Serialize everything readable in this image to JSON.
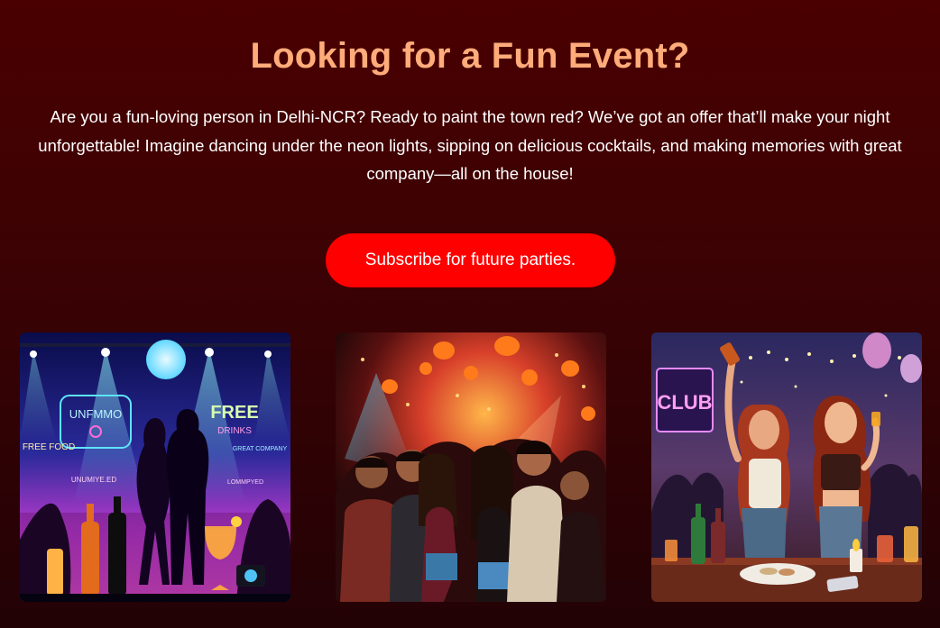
{
  "hero": {
    "title": "Looking for a Fun Event?",
    "description": "Are you a fun-loving person in Delhi-NCR? Ready to paint the town red? We’ve got an offer that’ll make your night unforgettable! Imagine dancing under the neon lights, sipping on delicious cocktails, and making memories with great company—all on the house!",
    "cta_label": "Subscribe for future parties."
  },
  "gallery": {
    "images": [
      {
        "neon_texts": [
          "UNFMMO",
          "FREE",
          "DRINKS",
          "FREE FOOD",
          "GREAT COMPANY",
          "UNUMIYE.ED",
          "LOMMPYED"
        ]
      },
      {
        "neon_texts": []
      },
      {
        "neon_texts": [
          "CLUB"
        ]
      }
    ]
  },
  "colors": {
    "title": "#ffac7a",
    "button": "#ff0000",
    "background_top": "#4a0000",
    "background_bottom": "#220205"
  }
}
